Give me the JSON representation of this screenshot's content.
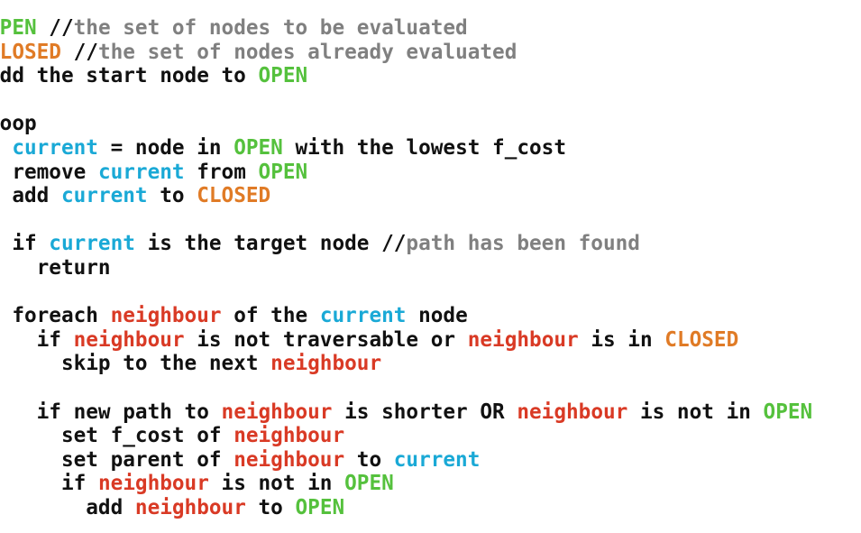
{
  "colors": {
    "plain": "#111111",
    "green": "#55c13d",
    "orange": "#e07b26",
    "cyan": "#1aa9d6",
    "red": "#d93a25",
    "gray": "#808080"
  },
  "code_lines": [
    [
      [
        "green",
        "OPEN"
      ],
      [
        "plain",
        " //"
      ],
      [
        "gray",
        "the set of nodes to be evaluated"
      ]
    ],
    [
      [
        "orange",
        "CLOSED"
      ],
      [
        "plain",
        " //"
      ],
      [
        "gray",
        "the set of nodes already evaluated"
      ]
    ],
    [
      [
        "plain",
        "add the start node to "
      ],
      [
        "green",
        "OPEN"
      ]
    ],
    [],
    [
      [
        "plain",
        "loop"
      ]
    ],
    [
      [
        "plain",
        "  "
      ],
      [
        "cyan",
        "current"
      ],
      [
        "plain",
        " = node in "
      ],
      [
        "green",
        "OPEN"
      ],
      [
        "plain",
        " with the lowest f_cost"
      ]
    ],
    [
      [
        "plain",
        "  remove "
      ],
      [
        "cyan",
        "current"
      ],
      [
        "plain",
        " from "
      ],
      [
        "green",
        "OPEN"
      ]
    ],
    [
      [
        "plain",
        "  add "
      ],
      [
        "cyan",
        "current"
      ],
      [
        "plain",
        " to "
      ],
      [
        "orange",
        "CLOSED"
      ]
    ],
    [],
    [
      [
        "plain",
        "  if "
      ],
      [
        "cyan",
        "current"
      ],
      [
        "plain",
        " is the target node //"
      ],
      [
        "gray",
        "path has been found"
      ]
    ],
    [
      [
        "plain",
        "    return"
      ]
    ],
    [],
    [
      [
        "plain",
        "  foreach "
      ],
      [
        "red",
        "neighbour"
      ],
      [
        "plain",
        " of the "
      ],
      [
        "cyan",
        "current"
      ],
      [
        "plain",
        " node"
      ]
    ],
    [
      [
        "plain",
        "    if "
      ],
      [
        "red",
        "neighbour"
      ],
      [
        "plain",
        " is not traversable or "
      ],
      [
        "red",
        "neighbour"
      ],
      [
        "plain",
        " is in "
      ],
      [
        "orange",
        "CLOSED"
      ]
    ],
    [
      [
        "plain",
        "      skip to the next "
      ],
      [
        "red",
        "neighbour"
      ]
    ],
    [],
    [
      [
        "plain",
        "    if new path to "
      ],
      [
        "red",
        "neighbour"
      ],
      [
        "plain",
        " is shorter OR "
      ],
      [
        "red",
        "neighbour"
      ],
      [
        "plain",
        " is not in "
      ],
      [
        "green",
        "OPEN"
      ]
    ],
    [
      [
        "plain",
        "      set f_cost of "
      ],
      [
        "red",
        "neighbour"
      ]
    ],
    [
      [
        "plain",
        "      set parent of "
      ],
      [
        "red",
        "neighbour"
      ],
      [
        "plain",
        " to "
      ],
      [
        "cyan",
        "current"
      ]
    ],
    [
      [
        "plain",
        "      if "
      ],
      [
        "red",
        "neighbour"
      ],
      [
        "plain",
        " is not in "
      ],
      [
        "green",
        "OPEN"
      ]
    ],
    [
      [
        "plain",
        "        add "
      ],
      [
        "red",
        "neighbour"
      ],
      [
        "plain",
        " to "
      ],
      [
        "green",
        "OPEN"
      ]
    ]
  ]
}
